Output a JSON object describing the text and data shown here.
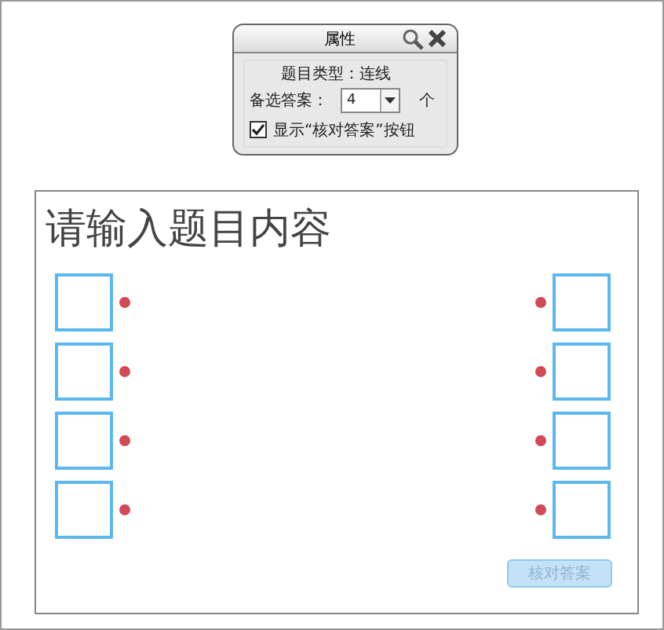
{
  "panel": {
    "title": "属性",
    "type_label": "题目类型：",
    "type_value": "连线",
    "count_label": "备选答案：",
    "count_value": "4",
    "count_unit": "个",
    "show_check": {
      "label": "显示“核对答案”按钮",
      "checked": true
    }
  },
  "canvas": {
    "prompt": "请输入题目内容",
    "rows": [
      {
        "kind": "pair"
      },
      {
        "kind": "pair"
      },
      {
        "kind": "pair"
      },
      {
        "kind": "pair"
      }
    ],
    "check_button": {
      "label": "核对答案",
      "disabled": true
    }
  }
}
